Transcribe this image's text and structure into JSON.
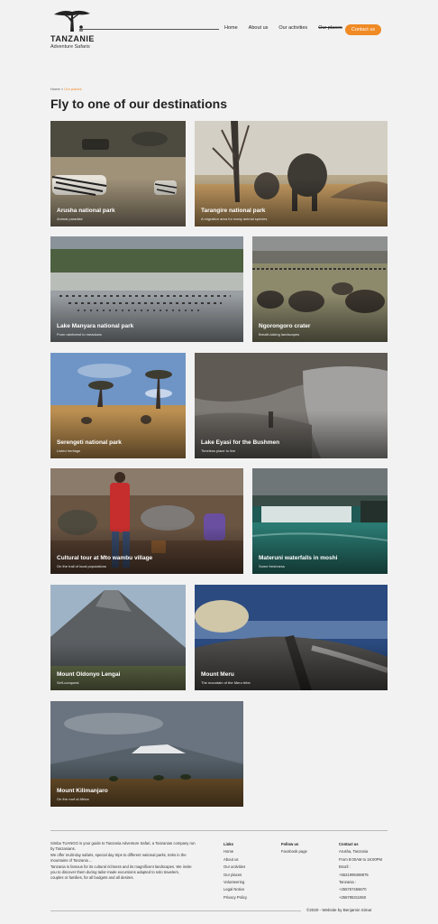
{
  "header": {
    "logo_title": "TANZANIE",
    "logo_sub": "Adventure Safaris",
    "nav": [
      "Home",
      "About us",
      "Our activities",
      "Our places"
    ],
    "contact_label": "Contact us"
  },
  "breadcrumb": {
    "home": "Home",
    "separator": ">",
    "current": "Our places"
  },
  "page_title": "Fly to one of our destinations",
  "cards": [
    {
      "title": "Arusha national park",
      "subtitle": "Animal paradise"
    },
    {
      "title": "Tarangire national park",
      "subtitle": "A migration area for many animal species"
    },
    {
      "title": "Lake Manyara national park",
      "subtitle": "From rainforest to meadows"
    },
    {
      "title": "Ngorongoro crater",
      "subtitle": "Breath-taking landscapes"
    },
    {
      "title": "Serengeti national park",
      "subtitle": "Listed heritage"
    },
    {
      "title": "Lake Eyasi for the Bushmen",
      "subtitle": "Timeless place to live"
    },
    {
      "title": "Cultural tour at Mto wambu village",
      "subtitle": "On the trail of local populations"
    },
    {
      "title": "Materuni waterfalls in moshi",
      "subtitle": "Some freshness"
    },
    {
      "title": "Mount Oldonyo Lengai",
      "subtitle": "Self-conquest"
    },
    {
      "title": "Mount Meru",
      "subtitle": "The mountain of the Meru tribe"
    },
    {
      "title": "Mount Kilimanjaro",
      "subtitle": "On the roof of Africa"
    }
  ],
  "footer": {
    "about_lines": [
      "Simba TUANGO is your guide to Tanzania Adventure Safari, a Tanzanian company run",
      "by Tanzanians.",
      "We offer multi-day safaris, special day trips to different national parks, treks in the",
      "mountains of Tanzania ...",
      "Tanzania is famous for its cultural richness and its magnificent landscapes. We invite",
      "you to discover them during tailor-made excursions adapted to solo travelers,",
      "couples or families, for all budgets and all desires."
    ],
    "links_head": "Links",
    "links": [
      "Home",
      "About us",
      "Our activities",
      "Our places",
      "Volunteering",
      "Legal Notice",
      "Privacy Policy"
    ],
    "follow_head": "Follow us",
    "follow": [
      "Facebook page"
    ],
    "contact_head": "Contact us",
    "contact": [
      "Arusha, Tanzania",
      "From 8:00AM to 18:00PM",
      "Brazil :",
      "+5521999488875",
      "Tanzania :",
      "+255767456670",
      "+255785311650"
    ],
    "copyright": "©2020 - Website by Benjamin Simar"
  },
  "colors": {
    "accent": "#f08a24",
    "background": "#f2f2f2"
  }
}
